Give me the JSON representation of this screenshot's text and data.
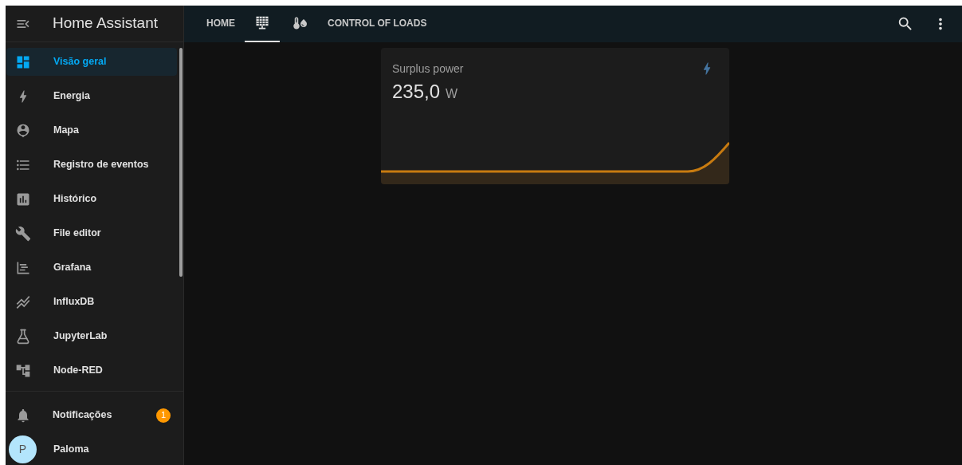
{
  "sidebar": {
    "title": "Home Assistant",
    "items": [
      {
        "label": "Visão geral",
        "selected": true
      },
      {
        "label": "Energia",
        "selected": false
      },
      {
        "label": "Mapa",
        "selected": false
      },
      {
        "label": "Registro de eventos",
        "selected": false
      },
      {
        "label": "Histórico",
        "selected": false
      },
      {
        "label": "File editor",
        "selected": false
      },
      {
        "label": "Grafana",
        "selected": false
      },
      {
        "label": "InfluxDB",
        "selected": false
      },
      {
        "label": "JupyterLab",
        "selected": false
      },
      {
        "label": "Node-RED",
        "selected": false
      }
    ],
    "notifications": {
      "label": "Notificações",
      "badge": "1"
    },
    "user": {
      "initial": "P",
      "name": "Paloma"
    }
  },
  "tabs": [
    {
      "kind": "text",
      "label": "HOME",
      "selected": false
    },
    {
      "kind": "icon",
      "selected": true
    },
    {
      "kind": "icon",
      "selected": false
    },
    {
      "kind": "text",
      "label": "CONTROL OF LOADS",
      "selected": false
    }
  ],
  "card": {
    "title": "Surplus power",
    "value": "235,0",
    "unit": "W"
  }
}
